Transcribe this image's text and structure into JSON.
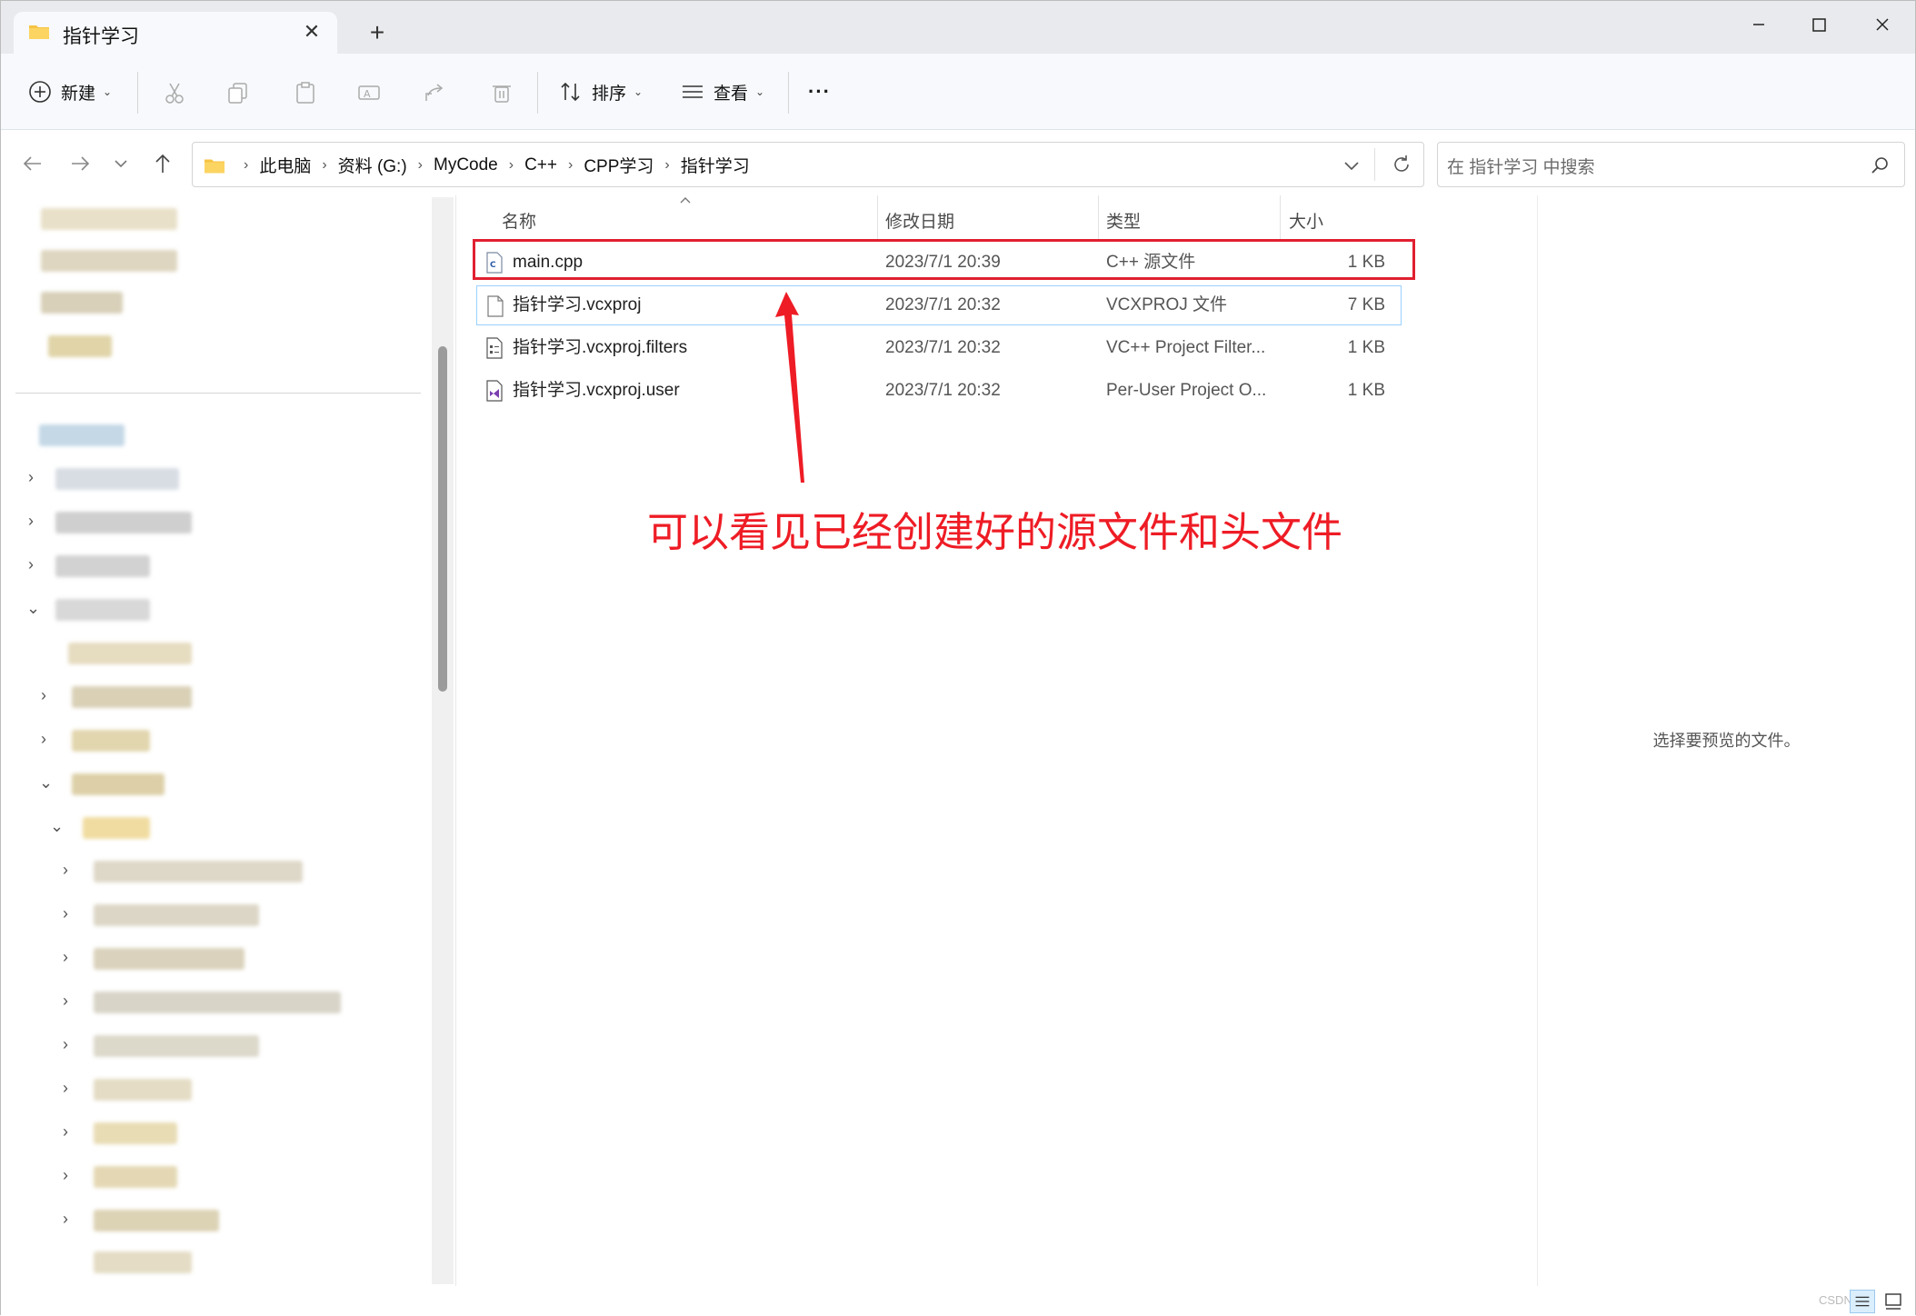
{
  "tab": {
    "title": "指针学习",
    "close": "✕",
    "new": "+"
  },
  "window_controls": {
    "minimize": "—",
    "maximize": "☐",
    "close": "✕"
  },
  "command_bar": {
    "new_label": "新建",
    "sort_label": "排序",
    "view_label": "查看",
    "more_label": "···"
  },
  "address_bar": {
    "breadcrumbs": [
      "此电脑",
      "资料 (G:)",
      "MyCode",
      "C++",
      "CPP学习",
      "指针学习"
    ],
    "search_placeholder": "在 指针学习 中搜索"
  },
  "file_list": {
    "columns": [
      "名称",
      "修改日期",
      "类型",
      "大小"
    ],
    "rows": [
      {
        "name": "main.cpp",
        "modified": "2023/7/1 20:39",
        "type": "C++ 源文件",
        "size": "1 KB",
        "icon": "cpp-file-icon"
      },
      {
        "name": "指针学习.vcxproj",
        "modified": "2023/7/1 20:32",
        "type": "VCXPROJ 文件",
        "size": "7 KB",
        "icon": "generic-file-icon"
      },
      {
        "name": "指针学习.vcxproj.filters",
        "modified": "2023/7/1 20:32",
        "type": "VC++ Project Filter...",
        "size": "1 KB",
        "icon": "filters-file-icon"
      },
      {
        "name": "指针学习.vcxproj.user",
        "modified": "2023/7/1 20:32",
        "type": "Per-User Project O...",
        "size": "1 KB",
        "icon": "vs-user-file-icon"
      }
    ]
  },
  "preview_pane": {
    "message": "选择要预览的文件。"
  },
  "annotation": {
    "text": "可以看见已经创建好的源文件和头文件",
    "color": "#ee1c25"
  },
  "watermark": "CSDN",
  "colors": {
    "accent": "#0067c0",
    "highlight_box": "#e02030",
    "folder": "#f6c343"
  }
}
